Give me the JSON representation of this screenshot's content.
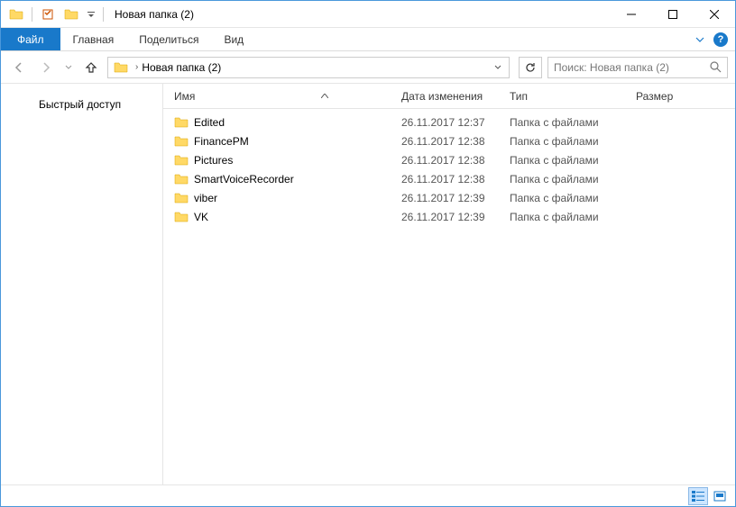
{
  "window": {
    "title": "Новая папка (2)"
  },
  "ribbon": {
    "file": "Файл",
    "tabs": [
      "Главная",
      "Поделиться",
      "Вид"
    ]
  },
  "breadcrumb": {
    "current": "Новая папка (2)"
  },
  "search": {
    "placeholder": "Поиск: Новая папка (2)"
  },
  "sidebar": {
    "quick_access": "Быстрый доступ"
  },
  "columns": {
    "name": "Имя",
    "date": "Дата изменения",
    "type": "Тип",
    "size": "Размер"
  },
  "items": [
    {
      "name": "Edited",
      "date": "26.11.2017 12:37",
      "type": "Папка с файлами"
    },
    {
      "name": "FinancePM",
      "date": "26.11.2017 12:38",
      "type": "Папка с файлами"
    },
    {
      "name": "Pictures",
      "date": "26.11.2017 12:38",
      "type": "Папка с файлами"
    },
    {
      "name": "SmartVoiceRecorder",
      "date": "26.11.2017 12:38",
      "type": "Папка с файлами"
    },
    {
      "name": "viber",
      "date": "26.11.2017 12:39",
      "type": "Папка с файлами"
    },
    {
      "name": "VK",
      "date": "26.11.2017 12:39",
      "type": "Папка с файлами"
    }
  ]
}
